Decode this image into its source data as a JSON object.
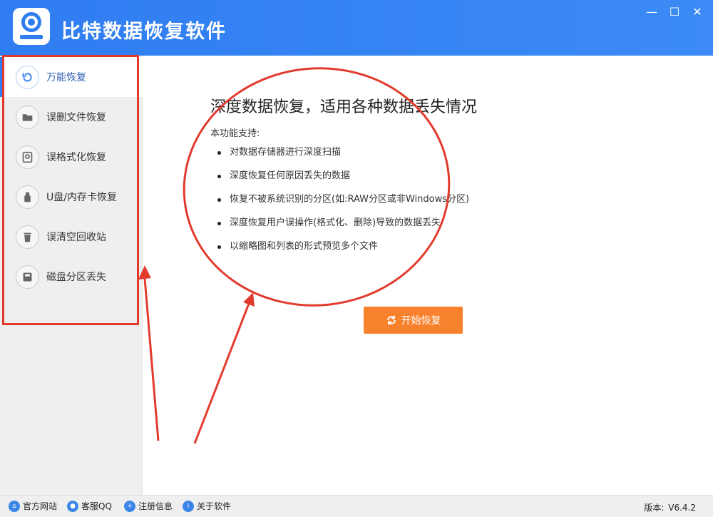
{
  "app": {
    "title": "比特数据恢复软件",
    "window_controls": {
      "minimize": "—",
      "maximize": "☐",
      "close": "✕"
    }
  },
  "sidebar": {
    "items": [
      {
        "label": "万能恢复",
        "icon": "undo-icon",
        "active": true
      },
      {
        "label": "误删文件恢复",
        "icon": "folder-icon",
        "active": false
      },
      {
        "label": "误格式化恢复",
        "icon": "format-disk-icon",
        "active": false
      },
      {
        "label": "U盘/内存卡恢复",
        "icon": "usb-drive-icon",
        "active": false
      },
      {
        "label": "误清空回收站",
        "icon": "trash-icon",
        "active": false
      },
      {
        "label": "磁盘分区丢失",
        "icon": "disk-partition-icon",
        "active": false
      }
    ]
  },
  "main": {
    "headline": "深度数据恢复，适用各种数据丢失情况",
    "subhead": "本功能支持:",
    "features": [
      "对数据存储器进行深度扫描",
      "深度恢复任何原因丢失的数据",
      "恢复不被系统识别的分区(如:RAW分区或非Windows分区)",
      "深度恢复用户误操作(格式化、删除)导致的数据丢失",
      "以缩略图和列表的形式预览多个文件"
    ],
    "start_button": "开始恢复"
  },
  "footer": {
    "links": [
      {
        "label": "官方网站",
        "icon": "home-icon"
      },
      {
        "label": "客服QQ",
        "icon": "qq-icon"
      },
      {
        "label": "注册信息",
        "icon": "user-plus-icon"
      },
      {
        "label": "关于软件",
        "icon": "info-icon"
      }
    ],
    "version_label": "版本:",
    "version": "V6.4.2"
  },
  "colors": {
    "brand_blue": "#2f7df1",
    "start_orange": "#f7812c",
    "annotation_red": "#e23b2e"
  }
}
